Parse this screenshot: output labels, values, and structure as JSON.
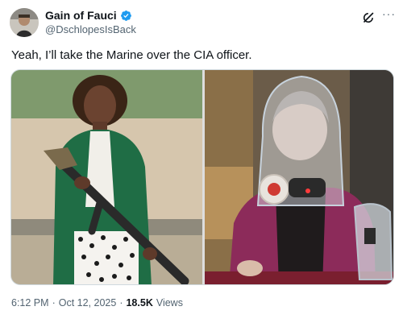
{
  "author": {
    "display_name": "Gain of Fauci",
    "handle": "@DschlopesIsBack",
    "verified": true
  },
  "icons": {
    "avatar": "avatar-image",
    "verified": "verified-badge-icon",
    "grok": "grok-icon",
    "more": "more-options-icon"
  },
  "more_glyph": "···",
  "tweet_text": "Yeah, I’ll take the Marine over the CIA officer.",
  "meta": {
    "time": "6:12 PM",
    "separator_1": "·",
    "date": "Oct 12, 2025",
    "separator_2": "·",
    "views_count": "18.5K",
    "views_label": "Views"
  },
  "colors": {
    "text_primary": "#0f1419",
    "text_secondary": "#536471",
    "verified_blue": "#1d9bf0",
    "border": "#cfd9de"
  }
}
